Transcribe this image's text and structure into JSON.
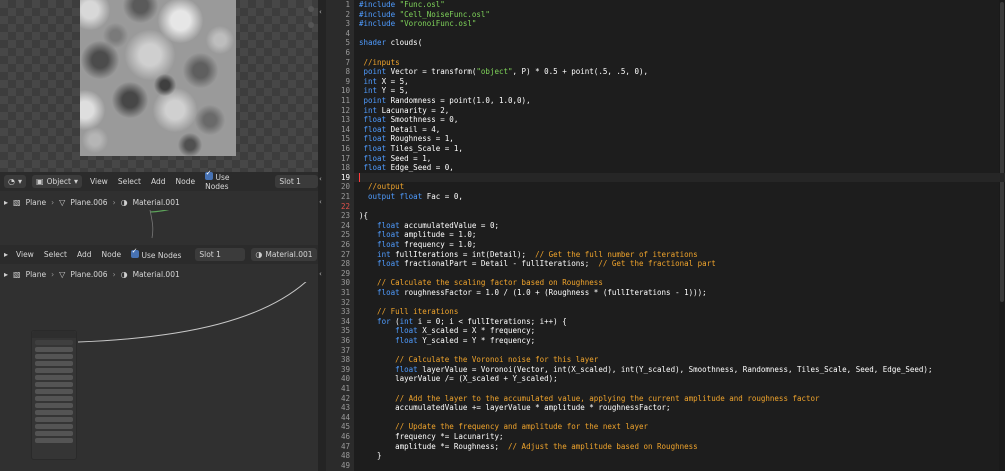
{
  "colors": {
    "keyword": "#4f9cff",
    "string": "#7fd35a",
    "comment": "#f0a42c",
    "number": "#ffffff",
    "type": "#4f9cff"
  },
  "node_editor_1": {
    "mode_dropdown": "Object",
    "menu": [
      "View",
      "Select",
      "Add",
      "Node"
    ],
    "use_nodes_label": "Use Nodes",
    "slot": "Slot 1",
    "breadcrumb": [
      "Plane",
      "Plane.006",
      "Material.001"
    ]
  },
  "node_editor_2": {
    "menu": [
      "View",
      "Select",
      "Add",
      "Node"
    ],
    "use_nodes_label": "Use Nodes",
    "slot": "Slot 1",
    "material": "Material.001",
    "breadcrumb": [
      "Plane",
      "Plane.006",
      "Material.001"
    ]
  },
  "code": {
    "lines": [
      {
        "n": "1",
        "segs": [
          [
            "#include ",
            "keyword"
          ],
          [
            "\"Func.osl\"",
            "string"
          ]
        ]
      },
      {
        "n": "2",
        "segs": [
          [
            "#include ",
            "keyword"
          ],
          [
            "\"Cell_NoiseFunc.osl\"",
            "string"
          ]
        ]
      },
      {
        "n": "3",
        "segs": [
          [
            "#include ",
            "keyword"
          ],
          [
            "\"VoronoiFunc.osl\"",
            "string"
          ]
        ]
      },
      {
        "n": "4",
        "segs": []
      },
      {
        "n": "5",
        "segs": [
          [
            "shader ",
            "keyword"
          ],
          [
            "clouds(",
            "plain"
          ]
        ]
      },
      {
        "n": "6",
        "segs": []
      },
      {
        "n": "7",
        "segs": [
          [
            " //inputs",
            "comment"
          ]
        ]
      },
      {
        "n": "8",
        "segs": [
          [
            " point ",
            "type"
          ],
          [
            "Vector = transform(",
            "plain"
          ],
          [
            "\"object\"",
            "string"
          ],
          [
            ", P) * 0.5 + point(.5, .5, 0),",
            "plain"
          ]
        ]
      },
      {
        "n": "9",
        "segs": [
          [
            " int ",
            "type"
          ],
          [
            "X = 5,",
            "plain"
          ]
        ]
      },
      {
        "n": "10",
        "segs": [
          [
            " int ",
            "type"
          ],
          [
            "Y = 5,",
            "plain"
          ]
        ]
      },
      {
        "n": "11",
        "segs": [
          [
            " point ",
            "type"
          ],
          [
            "Randomness = point(1.0, 1.0,0),",
            "plain"
          ]
        ]
      },
      {
        "n": "12",
        "segs": [
          [
            " int ",
            "type"
          ],
          [
            "Lacunarity = 2,",
            "plain"
          ]
        ]
      },
      {
        "n": "13",
        "segs": [
          [
            " float ",
            "type"
          ],
          [
            "Smoothness = 0,",
            "plain"
          ]
        ]
      },
      {
        "n": "14",
        "segs": [
          [
            " float ",
            "type"
          ],
          [
            "Detail = 4,",
            "plain"
          ]
        ]
      },
      {
        "n": "15",
        "segs": [
          [
            " float ",
            "type"
          ],
          [
            "Roughness = 1,",
            "plain"
          ]
        ]
      },
      {
        "n": "16",
        "segs": [
          [
            " float ",
            "type"
          ],
          [
            "Tiles_Scale = 1,",
            "plain"
          ]
        ]
      },
      {
        "n": "17",
        "segs": [
          [
            " float ",
            "type"
          ],
          [
            "Seed = 1,",
            "plain"
          ]
        ]
      },
      {
        "n": "18",
        "segs": [
          [
            " float ",
            "type"
          ],
          [
            "Edge_Seed = 0,",
            "plain"
          ]
        ]
      },
      {
        "n": "19",
        "segs": []
      },
      {
        "n": "20",
        "segs": [
          [
            "  //output",
            "comment"
          ]
        ]
      },
      {
        "n": "21",
        "segs": [
          [
            "  output float ",
            "type"
          ],
          [
            "Fac = 0,",
            "plain"
          ]
        ]
      },
      {
        "n": "22",
        "segs": []
      },
      {
        "n": "23",
        "segs": [
          [
            "){",
            "plain"
          ]
        ]
      },
      {
        "n": "24",
        "segs": [
          [
            "    float ",
            "type"
          ],
          [
            "accumulatedValue = 0;",
            "plain"
          ]
        ]
      },
      {
        "n": "25",
        "segs": [
          [
            "    float ",
            "type"
          ],
          [
            "amplitude = 1.0;",
            "plain"
          ]
        ]
      },
      {
        "n": "26",
        "segs": [
          [
            "    float ",
            "type"
          ],
          [
            "frequency = 1.0;",
            "plain"
          ]
        ]
      },
      {
        "n": "27",
        "segs": [
          [
            "    int ",
            "type"
          ],
          [
            "fullIterations = int(Detail);  ",
            "plain"
          ],
          [
            "// Get the full number of iterations",
            "comment"
          ]
        ]
      },
      {
        "n": "28",
        "segs": [
          [
            "    float ",
            "type"
          ],
          [
            "fractionalPart = Detail - fullIterations;  ",
            "plain"
          ],
          [
            "// Get the fractional part",
            "comment"
          ]
        ]
      },
      {
        "n": "29",
        "segs": []
      },
      {
        "n": "30",
        "segs": [
          [
            "    // Calculate the scaling factor based on Roughness",
            "comment"
          ]
        ]
      },
      {
        "n": "31",
        "segs": [
          [
            "    float ",
            "type"
          ],
          [
            "roughnessFactor = 1.0 / (1.0 + (Roughness * (fullIterations - 1)));",
            "plain"
          ]
        ]
      },
      {
        "n": "32",
        "segs": []
      },
      {
        "n": "33",
        "segs": [
          [
            "    // Full iterations",
            "comment"
          ]
        ]
      },
      {
        "n": "34",
        "segs": [
          [
            "    for ",
            "keyword"
          ],
          [
            "(",
            "plain"
          ],
          [
            "int ",
            "type"
          ],
          [
            "i = 0; i < fullIterations; i++) {",
            "plain"
          ]
        ]
      },
      {
        "n": "35",
        "segs": [
          [
            "        float ",
            "type"
          ],
          [
            "X_scaled = X * frequency;",
            "plain"
          ]
        ]
      },
      {
        "n": "36",
        "segs": [
          [
            "        float ",
            "type"
          ],
          [
            "Y_scaled = Y * frequency;",
            "plain"
          ]
        ]
      },
      {
        "n": "37",
        "segs": []
      },
      {
        "n": "38",
        "segs": [
          [
            "        // Calculate the Voronoi noise for this layer",
            "comment"
          ]
        ]
      },
      {
        "n": "39",
        "segs": [
          [
            "        float ",
            "type"
          ],
          [
            "layerValue = Voronoi(Vector, int(X_scaled), int(Y_scaled), Smoothness, Randomness, Tiles_Scale, Seed, Edge_Seed);",
            "plain"
          ]
        ]
      },
      {
        "n": "40",
        "segs": [
          [
            "        layerValue /= (X_scaled + Y_scaled);",
            "plain"
          ]
        ]
      },
      {
        "n": "41",
        "segs": []
      },
      {
        "n": "42",
        "segs": [
          [
            "        // Add the layer to the accumulated value, applying the current amplitude and roughness factor",
            "comment"
          ]
        ]
      },
      {
        "n": "43",
        "segs": [
          [
            "        accumulatedValue += layerValue * amplitude * roughnessFactor;",
            "plain"
          ]
        ]
      },
      {
        "n": "44",
        "segs": []
      },
      {
        "n": "45",
        "segs": [
          [
            "        // Update the frequency and amplitude for the next layer",
            "comment"
          ]
        ]
      },
      {
        "n": "46",
        "segs": [
          [
            "        frequency *= Lacunarity;",
            "plain"
          ]
        ]
      },
      {
        "n": "47",
        "segs": [
          [
            "        amplitude *= Roughness;  ",
            "plain"
          ],
          [
            "// Adjust the amplitude based on Roughness",
            "comment"
          ]
        ]
      },
      {
        "n": "48",
        "segs": [
          [
            "    }",
            "plain"
          ]
        ]
      },
      {
        "n": "49",
        "segs": []
      }
    ],
    "current_line": "19",
    "error_line": "22"
  }
}
